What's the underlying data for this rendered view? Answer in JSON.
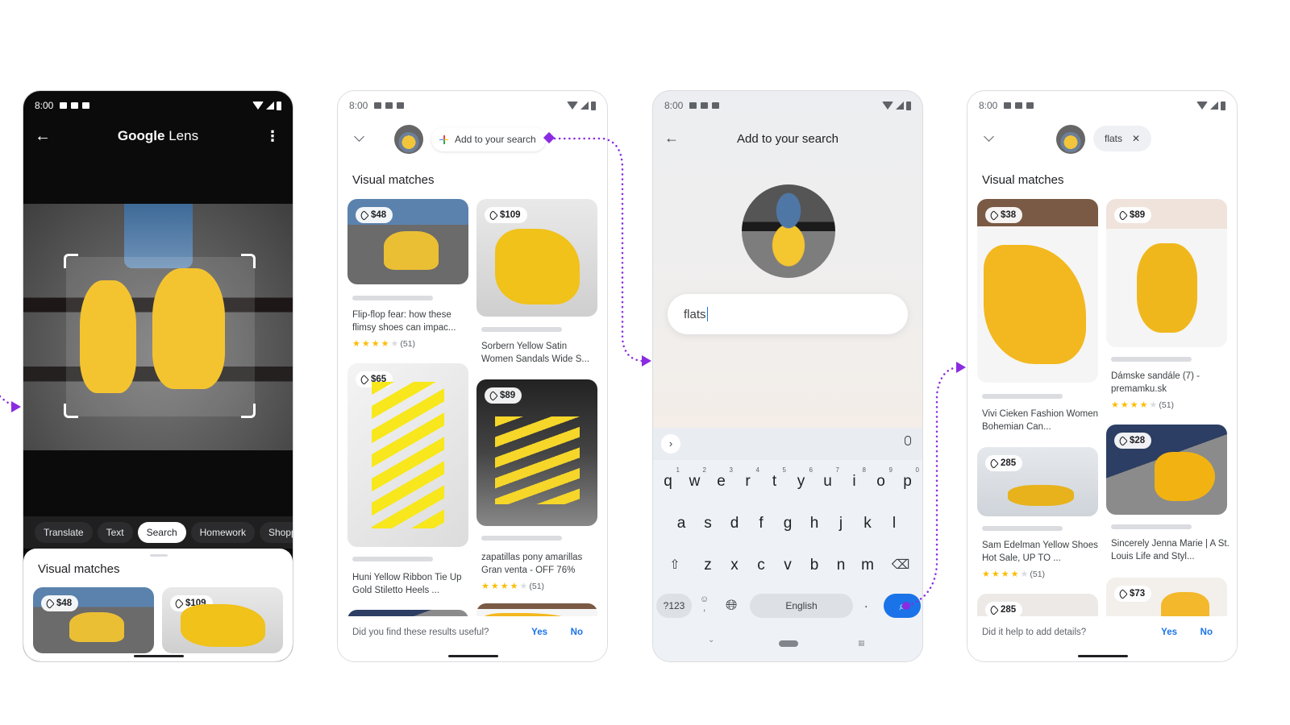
{
  "status_bar": {
    "time": "8:00"
  },
  "screen1": {
    "app_title_bold": "Google",
    "app_title_rest": " Lens",
    "modes": [
      "Translate",
      "Text",
      "Search",
      "Homework",
      "Shoppi"
    ],
    "active_mode": "Search",
    "results_title": "Visual matches",
    "results": [
      {
        "price": "$48"
      },
      {
        "price": "$109"
      }
    ]
  },
  "screen2": {
    "add_chip_label": "Add to your search",
    "results_title": "Visual matches",
    "results": [
      {
        "price": "$48",
        "title": "Flip-flop fear: how these flimsy shoes can impac...",
        "rating_count": "(51)",
        "stars": 4
      },
      {
        "price": "$109",
        "title": "Sorbern Yellow Satin Women Sandals Wide S..."
      },
      {
        "price": "$65",
        "title": "Huni Yellow Ribbon Tie Up Gold Stiletto Heels ..."
      },
      {
        "price": "$89",
        "title": "zapatillas pony amarillas Gran venta - OFF 76%",
        "rating_count": "(51)",
        "stars": 4
      }
    ],
    "feedback": {
      "question": "Did you find these results useful?",
      "yes": "Yes",
      "no": "No"
    }
  },
  "screen3": {
    "title": "Add to your search",
    "input_value": "flats",
    "keyboard": {
      "row1": [
        "q",
        "w",
        "e",
        "r",
        "t",
        "y",
        "u",
        "i",
        "o",
        "p"
      ],
      "row1_hints": [
        "1",
        "2",
        "3",
        "4",
        "5",
        "6",
        "7",
        "8",
        "9",
        "0"
      ],
      "row2": [
        "a",
        "s",
        "d",
        "f",
        "g",
        "h",
        "j",
        "k",
        "l"
      ],
      "row3": [
        "z",
        "x",
        "c",
        "v",
        "b",
        "n",
        "m"
      ],
      "symbols_key": "?123",
      "space_label": "English",
      "period_key": "."
    }
  },
  "screen4": {
    "query_chip": "flats",
    "results_title": "Visual matches",
    "results": [
      {
        "price": "$38",
        "title": "Vivi Cieken Fashion Women Bohemian Can..."
      },
      {
        "price": "$89",
        "title": "Dámske sandále (7) - premamku.sk",
        "rating_count": "(51)",
        "stars": 4
      },
      {
        "price": "285",
        "title": "Sam Edelman Yellow Shoes Hot Sale, UP TO ...",
        "rating_count": "(51)",
        "stars": 4
      },
      {
        "price": "$28",
        "title": "Sincerely Jenna Marie | A St. Louis Life and Styl..."
      },
      {
        "price": "285"
      },
      {
        "price": "$73"
      }
    ],
    "feedback": {
      "question": "Did it help to add details?",
      "yes": "Yes",
      "no": "No"
    }
  },
  "colors": {
    "flow_accent": "#8a2be2",
    "link_blue": "#1a73e8",
    "star": "#fbbc04"
  }
}
